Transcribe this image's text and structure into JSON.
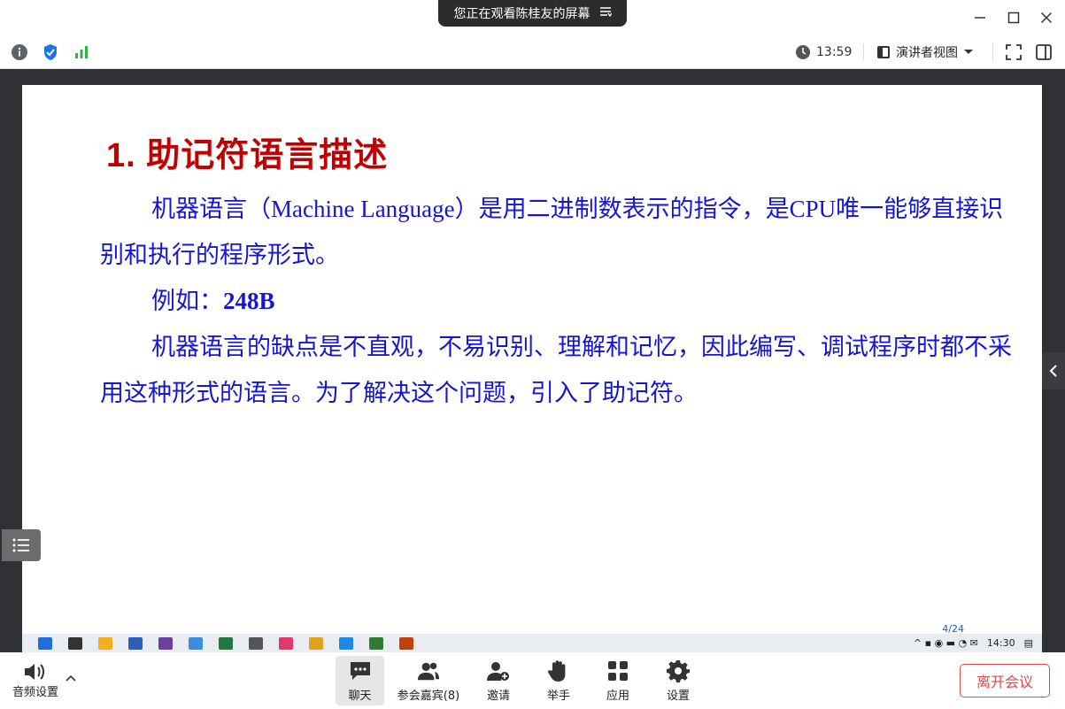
{
  "window": {
    "share_banner": "您正在观看陈桂友的屏幕",
    "minimize_label": "—",
    "maximize_label": "☐",
    "close_label": "✕"
  },
  "toolbar": {
    "time": "13:59",
    "view_mode": "演讲者视图"
  },
  "slide": {
    "title": "1. 助记符语言描述",
    "para1": "机器语言（Machine Language）是用二进制数表示的指令，是CPU唯一能够直接识别和执行的程序形式。",
    "para2_prefix": "例如：",
    "para2_value": "248B",
    "para3": "机器语言的缺点是不直观，不易识别、理解和记忆，因此编写、调试程序时都不采用这种形式的语言。为了解决这个问题，引入了助记符。",
    "page": "4/24"
  },
  "remote_taskbar": {
    "clock": "14:30",
    "icon_colors": [
      "#1e6fd9",
      "#333333",
      "#f2b01e",
      "#2b5fb8",
      "#6a3fa0",
      "#3c8de0",
      "#1f7a3d",
      "#555555",
      "#e03a6d",
      "#e0a21e",
      "#1e88e5",
      "#2e7d32",
      "#c2410c"
    ]
  },
  "bottombar": {
    "audio_label": "音频设置",
    "chat_label": "聊天",
    "participants_label": "参会嘉宾(8)",
    "invite_label": "邀请",
    "raise_hand_label": "举手",
    "apps_label": "应用",
    "settings_label": "设置",
    "leave_label": "离开会议"
  },
  "colors": {
    "title_red": "#c00000",
    "body_blue": "#1515d6",
    "leave_red": "#e0494a",
    "shield_blue": "#1e73e8",
    "signal_green": "#2fb34a"
  }
}
